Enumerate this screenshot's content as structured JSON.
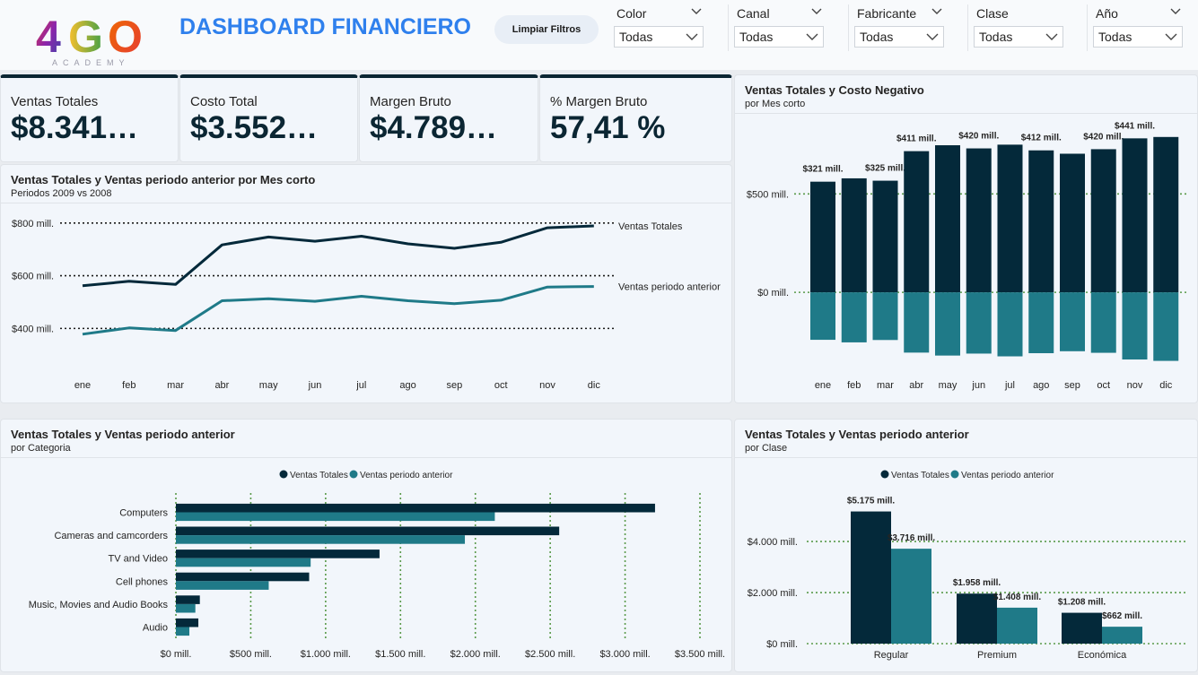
{
  "header": {
    "logo_text": "4GO",
    "logo_sub": "ACADEMY",
    "title": "DASHBOARD FINANCIERO",
    "clear_filters": "Limpiar Filtros"
  },
  "filters": [
    {
      "label": "Color",
      "value": "Todas"
    },
    {
      "label": "Canal",
      "value": "Todas"
    },
    {
      "label": "Fabricante",
      "value": "Todas"
    },
    {
      "label": "Clase",
      "value": "Todas"
    },
    {
      "label": "Año",
      "value": "Todas"
    }
  ],
  "kpis": [
    {
      "label": "Ventas Totales",
      "value": "$8.341…"
    },
    {
      "label": "Costo Total",
      "value": "$3.552…"
    },
    {
      "label": "Margen Bruto",
      "value": "$4.789…"
    },
    {
      "label": "% Margen Bruto",
      "value": "57,41 %"
    }
  ],
  "colors": {
    "dark": "#04293a",
    "teal": "#1f7a88",
    "accent": "#2f80ed",
    "grid": "#5a9a4a"
  },
  "charts": {
    "line": {
      "title": "Ventas Totales y Ventas periodo anterior por Mes corto",
      "subtitle": "Periodos 2009 vs 2008"
    },
    "bar_neg": {
      "title": "Ventas Totales y Costo Negativo",
      "subtitle": "por Mes corto"
    },
    "category": {
      "title": "Ventas Totales y Ventas periodo anterior",
      "subtitle": "por Categoria"
    },
    "clase": {
      "title": "Ventas Totales y Ventas periodo anterior",
      "subtitle": "por Clase"
    }
  },
  "chart_data": [
    {
      "type": "line",
      "x": [
        "ene",
        "feb",
        "mar",
        "abr",
        "may",
        "jun",
        "jul",
        "ago",
        "sep",
        "oct",
        "nov",
        "dic"
      ],
      "series": [
        {
          "name": "Ventas Totales",
          "values": [
            562,
            579,
            567,
            717,
            747,
            731,
            750,
            721,
            704,
            727,
            782,
            789
          ]
        },
        {
          "name": "Ventas periodo anterior",
          "values": [
            378,
            402,
            392,
            505,
            513,
            503,
            522,
            505,
            494,
            507,
            557,
            559
          ]
        }
      ],
      "yticks": [
        400,
        600,
        800
      ],
      "ytick_labels": [
        "$400 mill.",
        "$600 mill.",
        "$800 mill."
      ],
      "ylim": [
        340,
        830
      ],
      "grid": true
    },
    {
      "type": "bar",
      "categories": [
        "ene",
        "feb",
        "mar",
        "abr",
        "may",
        "jun",
        "jul",
        "ago",
        "sep",
        "oct",
        "nov",
        "dic"
      ],
      "series": [
        {
          "name": "Ventas Totales",
          "values": [
            562,
            579,
            567,
            717,
            747,
            731,
            750,
            721,
            704,
            727,
            782,
            789
          ]
        },
        {
          "name": "Costo Negativo",
          "values": [
            -241,
            -254,
            -242,
            -306,
            -321,
            -311,
            -325,
            -309,
            -299,
            -307,
            -341,
            -348
          ]
        }
      ],
      "data_labels": [
        "$321 mill.",
        "",
        "$325 mill.",
        "$411 mill.",
        "",
        "$420 mill.",
        "",
        "$412 mill.",
        "",
        "$420 mill.",
        "$441 mill.",
        ""
      ],
      "yticks": [
        0,
        500
      ],
      "ytick_labels": [
        "$0 mill.",
        "$500 mill."
      ],
      "ylim": [
        -400,
        820
      ],
      "grid": true
    },
    {
      "type": "bar",
      "orientation": "horizontal",
      "categories": [
        "Computers",
        "Cameras and camcorders",
        "TV and Video",
        "Cell phones",
        "Music, Movies and Audio Books",
        "Audio"
      ],
      "series": [
        {
          "name": "Ventas Totales",
          "values": [
            3200,
            2560,
            1360,
            890,
            160,
            150
          ]
        },
        {
          "name": "Ventas periodo anterior",
          "values": [
            2130,
            1930,
            900,
            620,
            130,
            90
          ]
        }
      ],
      "xticks": [
        0,
        500,
        1000,
        1500,
        2000,
        2500,
        3000,
        3500
      ],
      "xtick_labels": [
        "$0 mill.",
        "$500 mill.",
        "$1.000 mill.",
        "$1.500 mill.",
        "$2.000 mill.",
        "$2.500 mill.",
        "$3.000 mill.",
        "$3.500 mill."
      ],
      "xlim": [
        0,
        3500
      ],
      "legend": "top-center",
      "grid": true
    },
    {
      "type": "bar",
      "categories": [
        "Regular",
        "Premium",
        "Económica"
      ],
      "series": [
        {
          "name": "Ventas Totales",
          "values": [
            5175,
            1958,
            1208
          ],
          "labels": [
            "$5.175 mill.",
            "$1.958 mill.",
            "$1.208 mill."
          ]
        },
        {
          "name": "Ventas periodo anterior",
          "values": [
            3716,
            1408,
            662
          ],
          "labels": [
            "$3.716 mill.",
            "$1.408 mill.",
            "$662 mill."
          ]
        }
      ],
      "yticks": [
        0,
        2000,
        4000
      ],
      "ytick_labels": [
        "$0 mill.",
        "$2.000 mill.",
        "$4.000 mill."
      ],
      "ylim": [
        0,
        5300
      ],
      "legend": "top-center",
      "grid": true
    }
  ]
}
